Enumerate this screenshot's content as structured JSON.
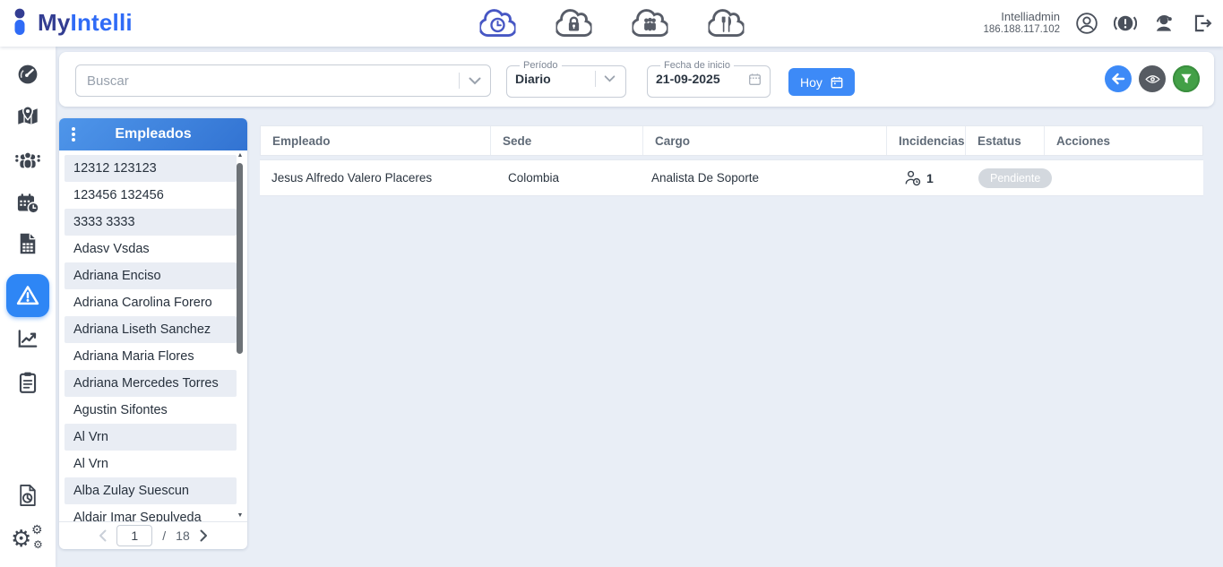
{
  "brand": {
    "prefix": "My",
    "suffix": "Intelli"
  },
  "header": {
    "user": {
      "name": "Intelliadmin",
      "ip": "186.188.117.102"
    },
    "modules": [
      {
        "icon": "cloud-time-icon",
        "active": true
      },
      {
        "icon": "cloud-lock-icon",
        "active": false
      },
      {
        "icon": "cloud-people-icon",
        "active": false
      },
      {
        "icon": "cloud-dining-icon",
        "active": false
      }
    ],
    "right_icons": [
      "profile-icon",
      "alert-icon",
      "support-agent-icon",
      "logout-icon"
    ]
  },
  "sidebar": {
    "icons": [
      "dashboard-icon",
      "map-icon",
      "people-icon",
      "calendar-clock-icon",
      "document-grid-icon",
      "warning-triangle-icon",
      "line-chart-icon",
      "clipboard-icon",
      "report-pie-icon",
      "gears-icon"
    ],
    "active_icon": "warning-triangle-icon"
  },
  "filters": {
    "search": {
      "placeholder": "Buscar"
    },
    "period": {
      "label": "Período",
      "value": "Diario"
    },
    "start_date": {
      "label": "Fecha de inicio",
      "value": "21-09-2025"
    },
    "today_button": "Hoy",
    "action_buttons": [
      "back-button",
      "view-button",
      "filter-button"
    ]
  },
  "employees_panel": {
    "title": "Empleados",
    "items": [
      "12312 123123",
      "123456 132456",
      "3333 3333",
      "Adasv Vsdas",
      "Adriana Enciso",
      "Adriana Carolina Forero",
      "Adriana Liseth Sanchez",
      "Adriana Maria Flores",
      "Adriana Mercedes Torres",
      "Agustin Sifontes",
      "Al Vrn",
      "Al Vrn",
      "Alba Zulay Suescun",
      "Aldair Imar Sepulveda"
    ],
    "pagination": {
      "current_page": "1",
      "separator": "/",
      "total_pages": "18"
    }
  },
  "table": {
    "columns": [
      "Empleado",
      "Sede",
      "Cargo",
      "Incidencias",
      "Estatus",
      "Acciones"
    ],
    "rows": [
      {
        "empleado": "Jesus Alfredo Valero Placeres",
        "sede": "Colombia",
        "cargo": "Analista De Soporte",
        "incidencias": "1",
        "estatus": "Pendiente"
      }
    ]
  },
  "colors": {
    "accent_blue": "#3d8af7",
    "active_sidebar": "#2e86f5",
    "brand_dark": "#333d92",
    "brand_blue": "#2f6bf6",
    "cloud_active": "#4757c4",
    "panel_header_from": "#4f96ea",
    "panel_header_to": "#3273d2",
    "green": "#43a047",
    "dark_gray": "#565b62",
    "row_alt": "#e9edf4",
    "badge_gray": "#d3d8de",
    "page_bg": "#e9eef6"
  }
}
